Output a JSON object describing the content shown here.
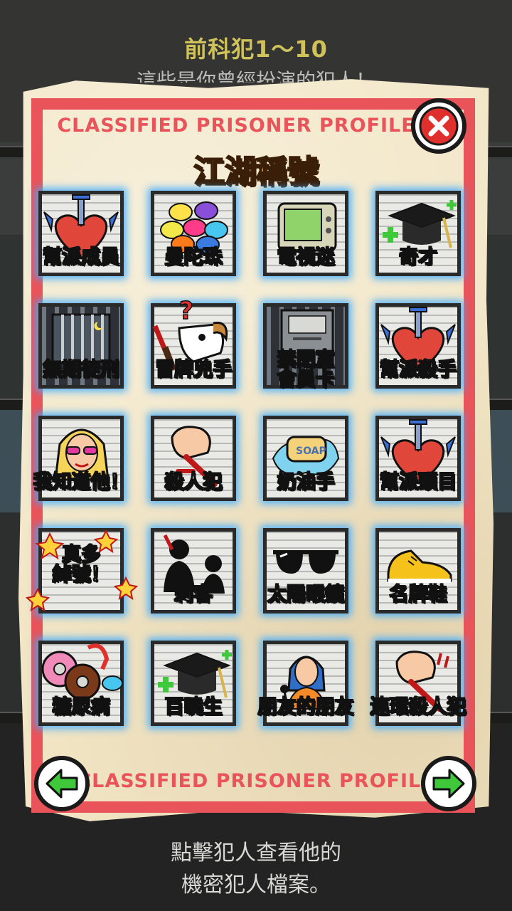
{
  "header": {
    "title": "前科犯1～10",
    "subtitle": "這些是你曾經扮演的犯人！"
  },
  "card": {
    "stamp_top": "CLASSIFIED PRISONER PROFILE",
    "stamp_bottom": "CLASSIFIED PRISONER PROFILE",
    "heading": "江湖稱號",
    "close_icon": "close-x-icon",
    "prev_icon": "arrow-left-icon",
    "next_icon": "arrow-right-icon",
    "accent_color": "#e8545a",
    "nav_arrow_color": "#3fc93a"
  },
  "badges": [
    {
      "label": "幫派成員",
      "icon": "winged-heart-dagger-icon"
    },
    {
      "label": "曼陀珠",
      "icon": "candy-pile-icon"
    },
    {
      "label": "電視迷",
      "icon": "old-tv-icon"
    },
    {
      "label": "奇才",
      "icon": "graduation-cap-plus-icon"
    },
    {
      "label": "無期徒刑",
      "icon": "jail-cell-icon",
      "style": "orange"
    },
    {
      "label": "冒牌兇手",
      "icon": "goat-knife-icon"
    },
    {
      "label": "禁閉室\n會員卡",
      "icon": "solitary-confinement-door-icon"
    },
    {
      "label": "幫派殺手",
      "icon": "winged-heart-dagger-icon"
    },
    {
      "label": "我知道他！",
      "icon": "celebrity-woman-icon"
    },
    {
      "label": "殺人犯",
      "icon": "fist-knife-icon"
    },
    {
      "label": "奶油手",
      "icon": "soap-splash-icon"
    },
    {
      "label": "幫派頭目",
      "icon": "winged-heart-dagger-icon"
    },
    {
      "label": "真多\n綽號！",
      "icon": "stars-burst-icon"
    },
    {
      "label": "刺客",
      "icon": "assassin-silhouette-icon"
    },
    {
      "label": "太陽眼鏡",
      "icon": "sunglasses-icon"
    },
    {
      "label": "名牌鞋",
      "icon": "yellow-sneaker-icon"
    },
    {
      "label": "糖尿病",
      "icon": "donuts-candy-icon"
    },
    {
      "label": "百曉生",
      "icon": "graduation-cap-plus-icon"
    },
    {
      "label": "朋友的朋友",
      "icon": "singer-girl-icon"
    },
    {
      "label": "連環殺人犯",
      "icon": "fist-knife-icon"
    }
  ],
  "footer": {
    "hint_line1": "點擊犯人查看他的",
    "hint_line2": "機密犯人檔案。"
  }
}
